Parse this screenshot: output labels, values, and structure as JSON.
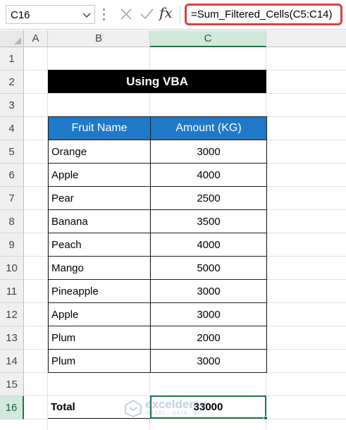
{
  "formula_bar": {
    "name_box": "C16",
    "formula": "=Sum_Filtered_Cells(C5:C14)",
    "fx_label": "fx"
  },
  "columns": [
    "A",
    "B",
    "C"
  ],
  "selected_column": "C",
  "rows": [
    "1",
    "2",
    "3",
    "4",
    "5",
    "6",
    "7",
    "8",
    "9",
    "10",
    "11",
    "12",
    "13",
    "14",
    "15",
    "16"
  ],
  "selected_row": "16",
  "sheet": {
    "title": "Using VBA",
    "headers": [
      "Fruit Name",
      "Amount (KG)"
    ],
    "data": [
      {
        "fruit": "Orange",
        "amount": "3000"
      },
      {
        "fruit": "Apple",
        "amount": "4000"
      },
      {
        "fruit": "Pear",
        "amount": "2500"
      },
      {
        "fruit": "Banana",
        "amount": "3500"
      },
      {
        "fruit": "Peach",
        "amount": "4000"
      },
      {
        "fruit": "Mango",
        "amount": "5000"
      },
      {
        "fruit": "Pineapple",
        "amount": "3000"
      },
      {
        "fruit": "Apple",
        "amount": "3000"
      },
      {
        "fruit": "Plum",
        "amount": "2000"
      },
      {
        "fruit": "Plum",
        "amount": "3000"
      }
    ],
    "total_label": "Total",
    "total_value": "33000"
  },
  "watermark": {
    "name": "exceldemy",
    "tagline": "EXCEL · DATA · BI"
  },
  "colors": {
    "header_blue": "#1f78c8",
    "title_black": "#000000",
    "select_green": "#217346",
    "formula_highlight": "#d94040"
  }
}
